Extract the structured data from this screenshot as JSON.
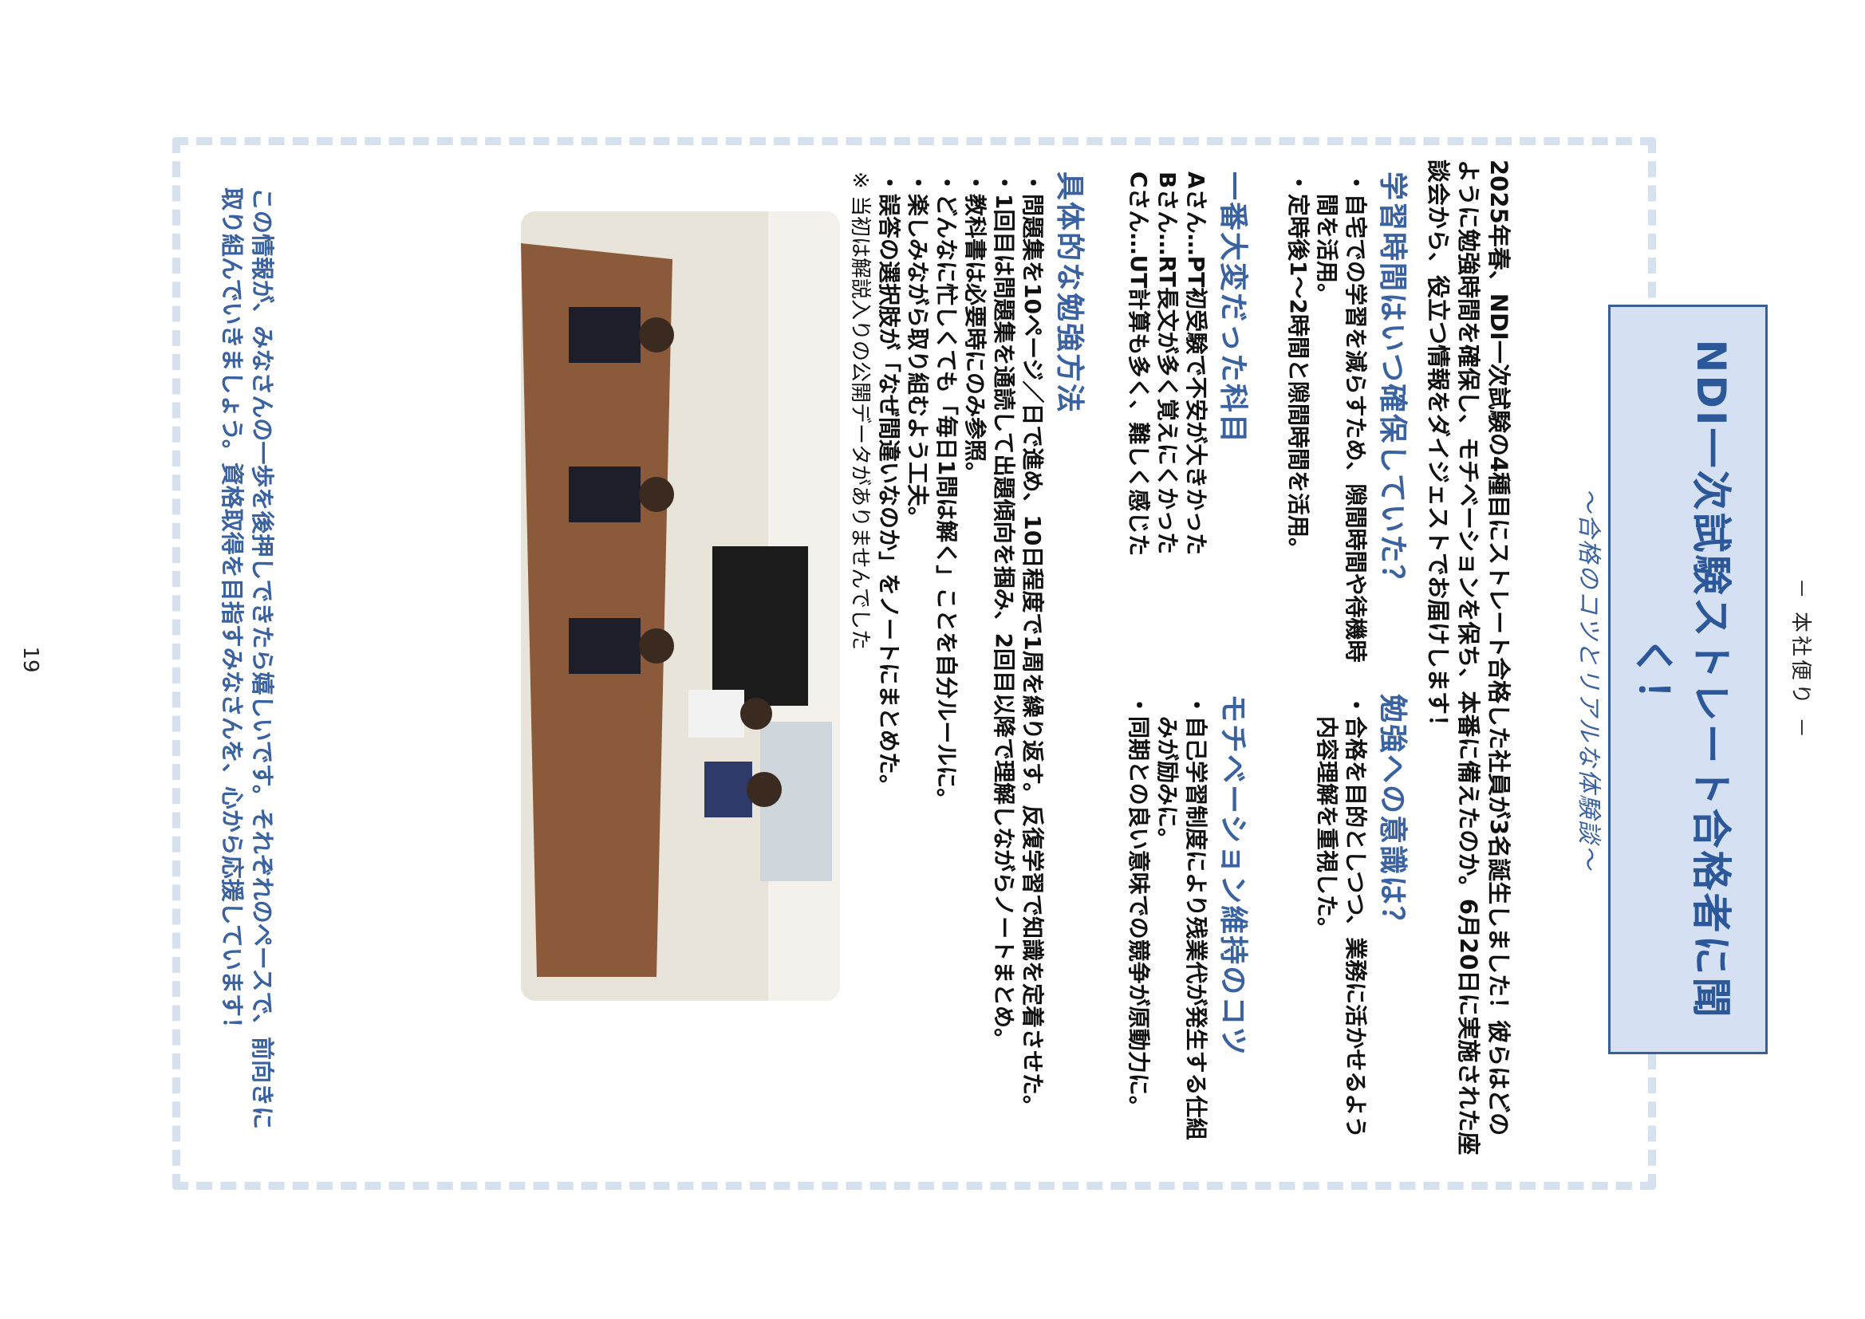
{
  "header": {
    "running_title": "－ 本社便り －"
  },
  "title": {
    "main": "NDI一次試験ストレート合格者に聞く！",
    "subtitle": "～合格のコツとリアルな体験談～"
  },
  "intro": "2025年春、NDI一次試験の4種目にストレート合格した社員が3名誕生しました！彼らはどのように勉強時間を確保し、モチベーションを保ち、本番に備えたのか。6月20日に実施された座談会から、役立つ情報をダイジェストでお届けします！",
  "sections": {
    "study_time": {
      "heading": "学習時間はいつ確保していた？",
      "items": [
        "自宅での学習を減らすため、隙間時間や待機時間を活用。",
        "定時後1～2時間と隙間時間を活用。"
      ]
    },
    "awareness": {
      "heading": "勉強への意識は？",
      "items": [
        "合格を目的としつつ、業務に活かせるよう内容理解を重視した。"
      ]
    },
    "hardest": {
      "heading": "一番大変だった科目",
      "lines": [
        "Aさん…PT初受験で不安が大きかった",
        "Bさん…RT長文が多く覚えにくかった",
        "Cさん…UT計算も多く、難しく感じた"
      ]
    },
    "motivation": {
      "heading": "モチベーション維持のコツ",
      "items": [
        "自己学習制度により残業代が発生する仕組みが励みに。",
        "同期との良い意味での競争が原動力に。"
      ]
    },
    "methods": {
      "heading": "具体的な勉強方法",
      "items": [
        "問題集を10ページ／日で進め、10日程度で1周を繰り返す。反復学習で知識を定着させた。",
        "1回目は問題集を通読して出題傾向を掴み、2回目以降で理解しながらノートまとめ。",
        "教科書は必要時にのみ参照。",
        "どんなに忙しくても「毎日1問は解く」ことを自分ルールに。",
        "楽しみながら取り組むよう工夫。",
        "誤答の選択肢が「なぜ間違いなのか」をノートにまとめた。"
      ],
      "note": "※ 当初は解説入りの公開データがありませんでした"
    }
  },
  "closing": "この情報が、みなさんの一歩を後押しできたら嬉しいです。それぞれのペースで、前向きに取り組んでいきましょう。資格取得を目指すみなさんを、心から応援しています！",
  "footer": {
    "page_number": "19"
  },
  "colors": {
    "accent": "#3a62a0",
    "title_bg": "#d5e1f2",
    "frame": "#d6e1f0"
  }
}
